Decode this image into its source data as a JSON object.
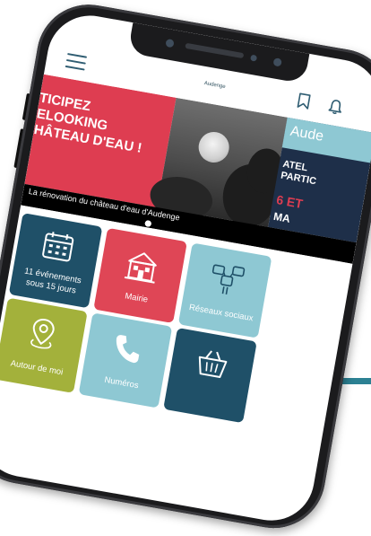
{
  "header": {
    "app_title": "Audenge"
  },
  "banner": {
    "slide1_lines": "TICIPEZ\nELOOKING\nHÂTEAU D'EAU !",
    "slide3_brand": "Aude",
    "slide3_lines": "ATEL\nPARTIC",
    "slide3_red": "6 ET",
    "slide3_white": "MA",
    "caption": "La rénovation du château d'eau d'Audenge"
  },
  "tiles": [
    {
      "label": "11 événements sous 15 jours",
      "color": "#1f5068",
      "icon": "calendar-icon"
    },
    {
      "label": "Mairie",
      "color": "#df4656",
      "icon": "town-hall-icon"
    },
    {
      "label": "Réseaux sociaux",
      "color": "#8ec8d3",
      "icon": "social-network-icon"
    },
    {
      "label": "Autour de moi",
      "color": "#a3b13b",
      "icon": "location-pin-icon"
    },
    {
      "label": "Numéros",
      "color": "#8ec8d3",
      "icon": "phone-icon"
    },
    {
      "label": "",
      "color": "#1f5068",
      "icon": "basket-icon"
    }
  ],
  "colors": {
    "accent_dark": "#1f5068",
    "accent_red": "#df4656",
    "accent_light": "#8ec8d3",
    "accent_green": "#a3b13b",
    "band": "#2c8193"
  }
}
